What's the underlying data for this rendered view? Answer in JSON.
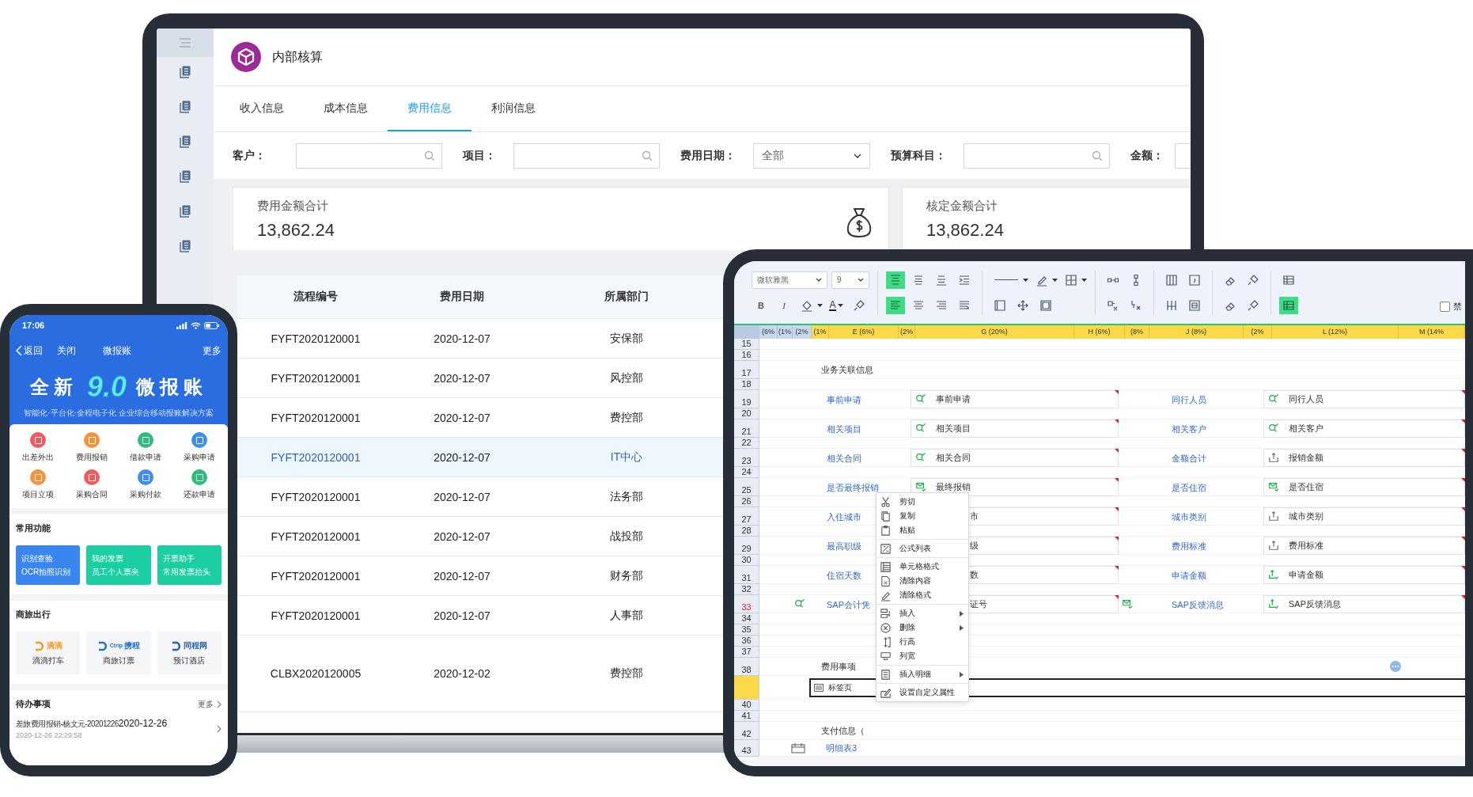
{
  "laptop": {
    "app_title": "内部核算",
    "tabs": [
      {
        "label": "收入信息",
        "selected": false
      },
      {
        "label": "成本信息",
        "selected": false
      },
      {
        "label": "费用信息",
        "selected": true
      },
      {
        "label": "利润信息",
        "selected": false
      }
    ],
    "filters": [
      {
        "label": "客户：",
        "kind": "search"
      },
      {
        "label": "项目：",
        "kind": "search"
      },
      {
        "label": "费用日期：",
        "kind": "select",
        "value": "全部"
      },
      {
        "label": "预算科目：",
        "kind": "search"
      },
      {
        "label": "金额：",
        "kind": "input"
      }
    ],
    "summary_cards": [
      {
        "title": "费用金额合计",
        "value": "13,862.24"
      },
      {
        "title": "核定金额合计",
        "value": "13,862.24"
      }
    ],
    "table": {
      "columns": [
        "流程编号",
        "费用日期",
        "所属部门"
      ],
      "rows": [
        {
          "cells": [
            "FYFT2020120001",
            "2020-12-07",
            "安保部"
          ],
          "selected": false
        },
        {
          "cells": [
            "FYFT2020120001",
            "2020-12-07",
            "风控部"
          ],
          "selected": false
        },
        {
          "cells": [
            "FYFT2020120001",
            "2020-12-07",
            "费控部"
          ],
          "selected": false
        },
        {
          "cells": [
            "FYFT2020120001",
            "2020-12-07",
            "IT中心"
          ],
          "selected": true
        },
        {
          "cells": [
            "FYFT2020120001",
            "2020-12-07",
            "法务部"
          ],
          "selected": false
        },
        {
          "cells": [
            "FYFT2020120001",
            "2020-12-07",
            "战投部"
          ],
          "selected": false
        },
        {
          "cells": [
            "FYFT2020120001",
            "2020-12-07",
            "财务部"
          ],
          "selected": false
        },
        {
          "cells": [
            "FYFT2020120001",
            "2020-12-07",
            "人事部"
          ],
          "selected": false
        },
        {
          "cells": [
            "CLBX2020120005",
            "2020-12-02",
            "费控部"
          ],
          "selected": false
        }
      ]
    }
  },
  "phone": {
    "time": "17:06",
    "nav": {
      "back": "返回",
      "close": "关闭",
      "title": "微报账",
      "more": "更多"
    },
    "banner": {
      "left": "全新",
      "version": "9.0",
      "right": "微报账",
      "subtitle": "智能化·平台化·全程电子化 企业综合移动报账解决方案"
    },
    "apps": [
      {
        "label": "出差外出",
        "color": "#f25b5b"
      },
      {
        "label": "费用报销",
        "color": "#f5933a"
      },
      {
        "label": "借款申请",
        "color": "#2dbd7c"
      },
      {
        "label": "采购申请",
        "color": "#3e8ef0"
      },
      {
        "label": "项目立项",
        "color": "#f5933a"
      },
      {
        "label": "采购合同",
        "color": "#f25b5b"
      },
      {
        "label": "采购付款",
        "color": "#3e8ef0"
      },
      {
        "label": "还款申请",
        "color": "#2dbd7c"
      }
    ],
    "common": {
      "title": "常用功能",
      "cards": [
        {
          "title": "识别查验",
          "subtitle": "OCR拍照识别",
          "color": "#3a86f0"
        },
        {
          "title": "我的发票",
          "subtitle": "员工个人票夹",
          "color": "#1ccfa2"
        },
        {
          "title": "开票助手",
          "subtitle": "常用发票抬头",
          "color": "#1ccfa2"
        }
      ]
    },
    "travel": {
      "title": "商旅出行",
      "items": [
        {
          "logo": "滴滴",
          "label": "滴滴打车",
          "color": "#f59a23"
        },
        {
          "logo": "携程",
          "caption": "Ctrip",
          "label": "商旅订票",
          "color": "#1f6fd6"
        },
        {
          "logo": "同程网",
          "label": "预订酒店",
          "color": "#2a5fb8"
        }
      ]
    },
    "todo": {
      "title": "待办事项",
      "more": "更多",
      "item": {
        "name": "差旅费用报销-杨文元-20201226",
        "date": "2020-12-26",
        "time": "2020-12-26 22:29:58"
      }
    }
  },
  "tablet": {
    "toolbar": {
      "font": "微软雅黑",
      "size": "9",
      "bold": "B",
      "italic": "I",
      "font_color": "A",
      "buttons": [
        {
          "on": false
        },
        {
          "on": false
        },
        {
          "on": true
        },
        {
          "on": false
        },
        {
          "on": false
        },
        {
          "on": false
        },
        {
          "on": true
        },
        {
          "on": false
        },
        {
          "on": false
        },
        {
          "on": false
        },
        {
          "on": false
        },
        {
          "on": false
        },
        {
          "on": false
        },
        {
          "on": false
        },
        {
          "on": false
        },
        {
          "on": false
        },
        {
          "on": false
        },
        {
          "on": false
        },
        {
          "on": false
        },
        {
          "on": false
        },
        {
          "on": false
        },
        {
          "on": false
        },
        {
          "on": false
        },
        {
          "on": false
        },
        {
          "on": false
        },
        {
          "on": false
        },
        {
          "on": false
        },
        {
          "on": false
        },
        {
          "on": false
        },
        {
          "on": true
        }
      ],
      "checkbox": {
        "label": "禁",
        "checked": false
      }
    },
    "columns": [
      {
        "label": "(6%",
        "selected": true
      },
      {
        "label": "(1%",
        "selected": true
      },
      {
        "label": "(2%",
        "selected": true
      },
      {
        "label": "(1%",
        "selected": false
      },
      {
        "label": "E (6%)",
        "selected": false
      },
      {
        "label": "(2%",
        "selected": false
      },
      {
        "label": "G (20%)",
        "selected": false
      },
      {
        "label": "H (6%)",
        "selected": false
      },
      {
        "label": "(8%",
        "selected": false
      },
      {
        "label": "J (8%)",
        "selected": false
      },
      {
        "label": "(2%",
        "selected": false
      },
      {
        "label": "L (12%)",
        "selected": false
      },
      {
        "label": "M (14%",
        "selected": false
      }
    ],
    "rows": [
      {
        "number": "15",
        "kind": "blank",
        "selected": false,
        "current": false
      },
      {
        "number": "16",
        "kind": "blank",
        "selected": false,
        "current": false
      },
      {
        "number": "17",
        "kind": "section",
        "text": "业务关联信息",
        "selected": false,
        "current": false
      },
      {
        "number": "18",
        "kind": "blank",
        "selected": false,
        "current": false
      },
      {
        "number": "19",
        "kind": "fields",
        "selected": false,
        "current": false,
        "pairs": [
          {
            "label": "事前申请",
            "value": "事前申请",
            "kind": "lookup"
          },
          {
            "label": "同行人员",
            "value": "同行人员",
            "kind": "lookup"
          }
        ]
      },
      {
        "number": "20",
        "kind": "blank",
        "selected": false,
        "current": false
      },
      {
        "number": "21",
        "kind": "fields",
        "selected": false,
        "current": false,
        "pairs": [
          {
            "label": "相关项目",
            "value": "相关项目",
            "kind": "lookup"
          },
          {
            "label": "相关客户",
            "value": "相关客户",
            "kind": "lookup"
          }
        ]
      },
      {
        "number": "22",
        "kind": "blank",
        "selected": false,
        "current": false
      },
      {
        "number": "23",
        "kind": "fields",
        "selected": false,
        "current": false,
        "pairs": [
          {
            "label": "相关合同",
            "value": "相关合同",
            "kind": "lookup"
          },
          {
            "label": "金额合计",
            "value": "报销金额",
            "kind": "amount"
          }
        ]
      },
      {
        "number": "24",
        "kind": "blank",
        "selected": false,
        "current": false
      },
      {
        "number": "25",
        "kind": "fields",
        "selected": false,
        "current": false,
        "pairs": [
          {
            "label": "是否最终报销",
            "value": "最终报销",
            "kind": "check"
          },
          {
            "label": "是否住宿",
            "value": "是否住宿",
            "kind": "check"
          }
        ]
      },
      {
        "number": "26",
        "kind": "blank",
        "selected": false,
        "current": false
      },
      {
        "number": "27",
        "kind": "fields",
        "selected": false,
        "current": false,
        "pairs": [
          {
            "label": "入住城市",
            "value": "市",
            "kind": "plain"
          },
          {
            "label": "城市类别",
            "value": "城市类别",
            "kind": "amount"
          }
        ]
      },
      {
        "number": "28",
        "kind": "blank",
        "selected": false,
        "current": false
      },
      {
        "number": "29",
        "kind": "fields",
        "selected": false,
        "current": false,
        "pairs": [
          {
            "label": "最高职级",
            "value": "级",
            "kind": "plain"
          },
          {
            "label": "费用标准",
            "value": "费用标准",
            "kind": "amount"
          }
        ]
      },
      {
        "number": "30",
        "kind": "blank",
        "selected": false,
        "current": false
      },
      {
        "number": "31",
        "kind": "fields",
        "selected": false,
        "current": false,
        "pairs": [
          {
            "label": "住宿天数",
            "value": "数",
            "kind": "plain"
          },
          {
            "label": "申请金额",
            "value": "申请金额",
            "kind": "confirmed"
          }
        ]
      },
      {
        "number": "32",
        "kind": "blank",
        "selected": false,
        "current": false
      },
      {
        "number": "33",
        "kind": "fields",
        "selected": false,
        "current": true,
        "markers": true,
        "pairs": [
          {
            "label": "SAP会计凭",
            "value": "证号",
            "kind": "plain"
          },
          {
            "label": "SAP反馈消息",
            "value": "SAP反馈消息",
            "kind": "confirmed"
          }
        ]
      },
      {
        "number": "34",
        "kind": "blank",
        "selected": false,
        "current": false
      },
      {
        "number": "35",
        "kind": "blank",
        "selected": false,
        "current": false
      },
      {
        "number": "36",
        "kind": "blank",
        "selected": false,
        "current": false
      },
      {
        "number": "37",
        "kind": "blank",
        "selected": false,
        "current": false
      },
      {
        "number": "38",
        "kind": "section",
        "text": "费用事项",
        "more_button": true,
        "selected": false,
        "current": false
      },
      {
        "kind": "tab",
        "text": "标签页",
        "selected": true,
        "current": false
      },
      {
        "number": "40",
        "kind": "blank",
        "selected": false,
        "current": false
      },
      {
        "number": "41",
        "kind": "blank",
        "selected": false,
        "current": false
      },
      {
        "number": "42",
        "kind": "section",
        "text": "支付信息（",
        "selected": false,
        "current": false
      },
      {
        "number": "43",
        "kind": "detail",
        "text": "明细表3",
        "selected": false,
        "current": false
      }
    ],
    "context_menu": [
      [
        {
          "label": "剪切",
          "submenu": false
        },
        {
          "label": "复制",
          "submenu": false
        },
        {
          "label": "粘贴",
          "submenu": false
        }
      ],
      [
        {
          "label": "公式列表",
          "submenu": false
        }
      ],
      [
        {
          "label": "单元格格式",
          "submenu": false
        },
        {
          "label": "清除内容",
          "submenu": false
        },
        {
          "label": "清除格式",
          "submenu": false
        }
      ],
      [
        {
          "label": "插入",
          "submenu": true
        },
        {
          "label": "删除",
          "submenu": true
        },
        {
          "label": "行高",
          "submenu": false
        },
        {
          "label": "列宽",
          "submenu": false
        }
      ],
      [
        {
          "label": "插入明细",
          "submenu": true
        }
      ],
      [
        {
          "label": "设置自定义属性",
          "submenu": false
        }
      ]
    ]
  }
}
